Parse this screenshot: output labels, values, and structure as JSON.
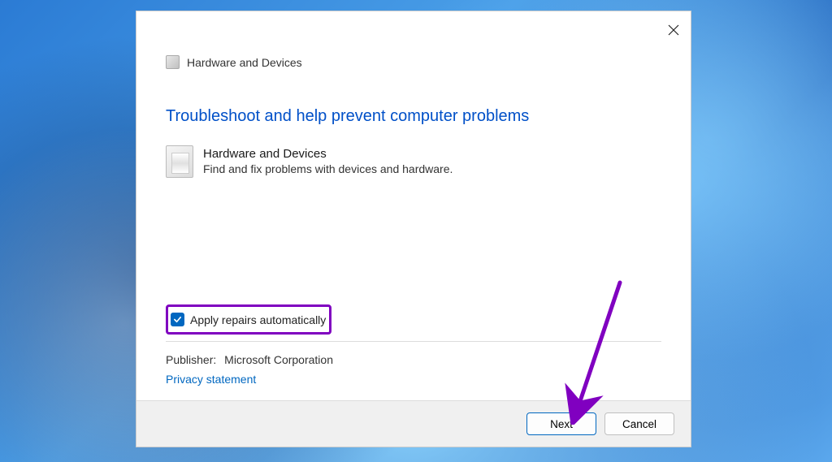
{
  "dialog": {
    "header_text": "Hardware and Devices",
    "main_heading": "Troubleshoot and help prevent computer problems",
    "troubleshooter": {
      "title": "Hardware and Devices",
      "description": "Find and fix problems with devices and hardware."
    },
    "checkbox_label": "Apply repairs automatically",
    "checkbox_checked": true,
    "publisher_label": "Publisher:",
    "publisher_value": "Microsoft Corporation",
    "privacy_link": "Privacy statement",
    "buttons": {
      "next": "Next",
      "cancel": "Cancel"
    }
  },
  "annotation": {
    "highlight_color": "#8000c0",
    "arrow_present": true
  }
}
